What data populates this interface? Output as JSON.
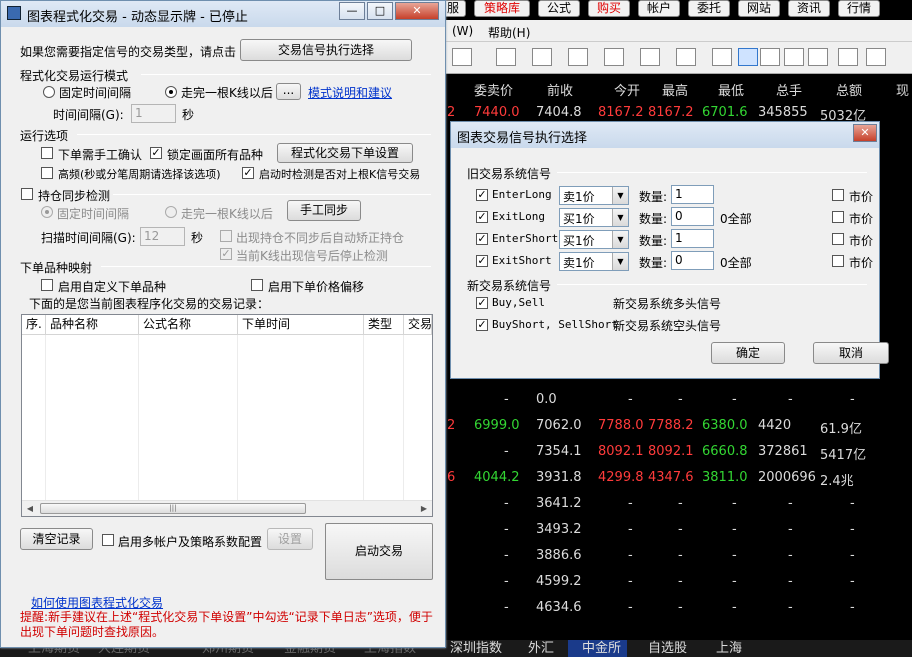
{
  "terminal": {
    "topnav": [
      "服",
      "策略库",
      "公式",
      "购买",
      "帐户",
      "委托",
      "网站",
      "资讯",
      "行情"
    ],
    "menu": {
      "w": "(W)",
      "help": "帮助(H)"
    },
    "columns": [
      "委卖价",
      "前收",
      "今开",
      "最高",
      "最低",
      "总手",
      "总额",
      "现"
    ],
    "row_top": {
      "mark": "2",
      "sell": "7440.0",
      "prev": "7404.8",
      "open": "8167.2",
      "high": "8167.2",
      "low": "6701.6",
      "vol": "345855",
      "amt": "5032亿"
    },
    "rows": [
      {
        "mark": "",
        "sell": "-",
        "prev": "0.0",
        "open": "-",
        "high": "-",
        "low": "-",
        "vol": "-",
        "amt": "-"
      },
      {
        "mark": "2",
        "sell": "6999.0",
        "prev": "7062.0",
        "open": "7788.0",
        "high": "7788.2",
        "low": "6380.0",
        "vol": "4420",
        "amt": "61.9亿"
      },
      {
        "mark": "",
        "sell": "-",
        "prev": "7354.1",
        "open": "8092.1",
        "high": "8092.1",
        "low": "6660.8",
        "vol": "372861",
        "amt": "5417亿"
      },
      {
        "mark": "6",
        "sell": "4044.2",
        "prev": "3931.8",
        "open": "4299.8",
        "high": "4347.6",
        "low": "3811.0",
        "vol": "2000696",
        "amt": "2.4兆"
      },
      {
        "mark": "",
        "sell": "-",
        "prev": "3641.2",
        "open": "-",
        "high": "-",
        "low": "-",
        "vol": "-",
        "amt": "-"
      },
      {
        "mark": "",
        "sell": "-",
        "prev": "3493.2",
        "open": "-",
        "high": "-",
        "low": "-",
        "vol": "-",
        "amt": "-"
      },
      {
        "mark": "",
        "sell": "-",
        "prev": "3886.6",
        "open": "-",
        "high": "-",
        "low": "-",
        "vol": "-",
        "amt": "-"
      },
      {
        "mark": "",
        "sell": "-",
        "prev": "4599.2",
        "open": "-",
        "high": "-",
        "low": "-",
        "vol": "-",
        "amt": "-"
      },
      {
        "mark": "",
        "sell": "-",
        "prev": "4634.6",
        "open": "-",
        "high": "-",
        "low": "-",
        "vol": "-",
        "amt": "-"
      }
    ],
    "bottom_tabs": [
      "深圳指数",
      "外汇",
      "中金所",
      "自选股",
      "上海"
    ],
    "bottom_left": [
      "上海期货",
      "大连期货",
      "郑州期货",
      "金融期货",
      "上海指数"
    ]
  },
  "main": {
    "title": "图表程式化交易 - 动态显示牌 - 已停止",
    "prompt": "如果您需要指定信号的交易类型，请点击",
    "signal_btn": "交易信号执行选择",
    "mode_section": "程式化交易运行模式",
    "fixed_interval": "固定时间间隔",
    "after_kline": "走完一根K线以后",
    "ellipsis": "...",
    "mode_help_link": "模式说明和建议",
    "interval_label": "时间间隔(G):",
    "interval_value": "1",
    "interval_unit": "秒",
    "run_section": "运行选项",
    "manual_confirm": "下单需手工确认",
    "lock_all": "锁定画面所有品种",
    "order_settings_btn": "程式化交易下单设置",
    "high_freq": "高频(秒或分笔周期请选择该选项)",
    "check_prev": "启动时检测是否对上根K信号交易",
    "sync_section": "持仓同步检测",
    "sync_fixed": "固定时间间隔",
    "sync_kline": "走完一根K线以后",
    "manual_sync_btn": "手工同步",
    "scan_label": "扫描时间间隔(G):",
    "scan_value": "12",
    "scan_unit": "秒",
    "auto_correct": "出现持仓不同步后自动矫正持仓",
    "stop_check": "当前K线出现信号后停止检测",
    "map_section": "下单品种映射",
    "custom_symbol": "启用自定义下单品种",
    "price_offset": "启用下单价格偏移",
    "records_label": "下面的是您当前图表程序化交易的交易记录：",
    "table_headers": [
      "序.",
      "品种名称",
      "公式名称",
      "下单时间",
      "类型",
      "交易"
    ],
    "clear_btn": "清空记录",
    "multi_account": "启用多帐户及策略系数配置",
    "settings_btn": "设置",
    "start_btn": "启动交易",
    "how_to_link": "如何使用图表程式化交易",
    "note": "提醒:新手建议在上述“程式化交易下单设置”中勾选“记录下单日志”选项，便于出现下单问题时查找原因。"
  },
  "dialog": {
    "title": "图表交易信号执行选择",
    "old_section": "旧交易系统信号",
    "rows": [
      {
        "name": "EnterLong",
        "type": "卖1价",
        "qty_label": "数量:",
        "qty": "1",
        "all": "",
        "market": "市价"
      },
      {
        "name": "ExitLong",
        "type": "买1价",
        "qty_label": "数量:",
        "qty": "0",
        "all": "0全部",
        "market": "市价"
      },
      {
        "name": "EnterShort",
        "type": "买1价",
        "qty_label": "数量:",
        "qty": "1",
        "all": "",
        "market": "市价"
      },
      {
        "name": "ExitShort",
        "type": "卖1价",
        "qty_label": "数量:",
        "qty": "0",
        "all": "0全部",
        "market": "市价"
      }
    ],
    "new_section": "新交易系统信号",
    "new_rows": [
      {
        "name": "Buy,Sell",
        "desc": "新交易系统多头信号"
      },
      {
        "name": "BuyShort, SellShort",
        "desc": "新交易系统空头信号"
      }
    ],
    "ok_btn": "确定",
    "cancel_btn": "取消"
  }
}
